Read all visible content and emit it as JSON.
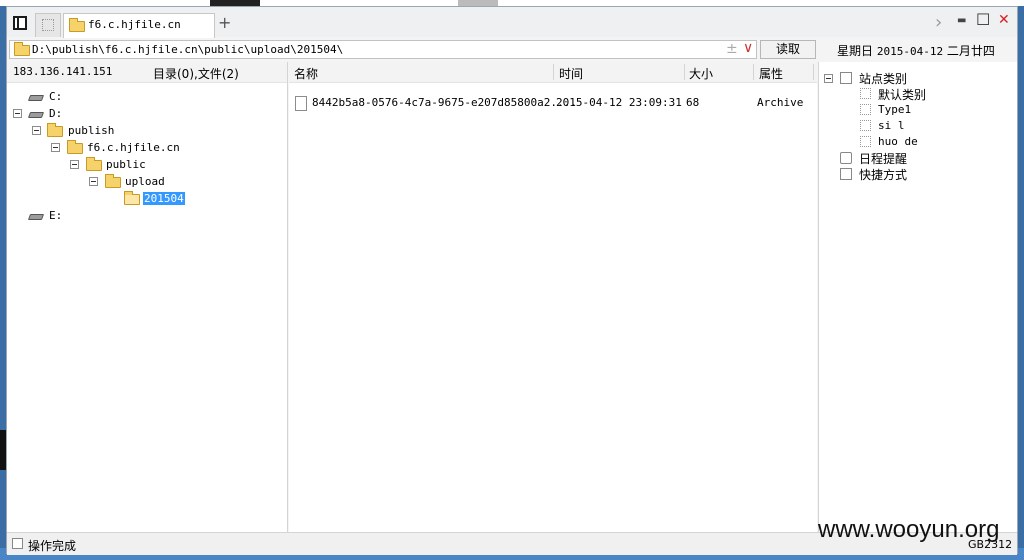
{
  "window": {
    "tab": {
      "label": "f6.c.hjfile.cn"
    },
    "tab_add": "+",
    "controls": {
      "nav": "›",
      "minimize": "▬",
      "maximize": "☐",
      "close": "✕"
    }
  },
  "address_bar": {
    "path": "D:\\publish\\f6.c.hjfile.cn\\public\\upload\\201504\\",
    "fav_glyph": "±",
    "dropdown_glyph": "∨",
    "read_button": "读取"
  },
  "date_display": {
    "weekday": "星期日",
    "date": "2015-04-12",
    "lunar": "二月廿四"
  },
  "left_panel": {
    "ip": "183.136.141.151",
    "summary": "目录(0),文件(2)",
    "tree": [
      {
        "label": "C:"
      },
      {
        "label": "D:"
      },
      {
        "label": "publish"
      },
      {
        "label": "f6.c.hjfile.cn"
      },
      {
        "label": "public"
      },
      {
        "label": "upload"
      },
      {
        "label": "201504",
        "selected": true
      },
      {
        "label": "E:"
      }
    ]
  },
  "file_list": {
    "columns": {
      "name": "名称",
      "time": "时间",
      "size": "大小",
      "attr": "属性"
    },
    "rows": [
      {
        "name": "8442b5a8-0576-4c7a-9675-e207d85800a2....",
        "time": "2015-04-12 23:09:31",
        "size": "68",
        "attr": "Archive"
      }
    ]
  },
  "right_panel": {
    "site_category": "站点类别",
    "categories": [
      "默认类别",
      "Type1",
      "si l",
      "huo de"
    ],
    "schedule": "日程提醒",
    "shortcuts": "快捷方式"
  },
  "status": {
    "text": "操作完成",
    "encoding": "GB2312"
  },
  "watermark": "www.wooyun.org"
}
